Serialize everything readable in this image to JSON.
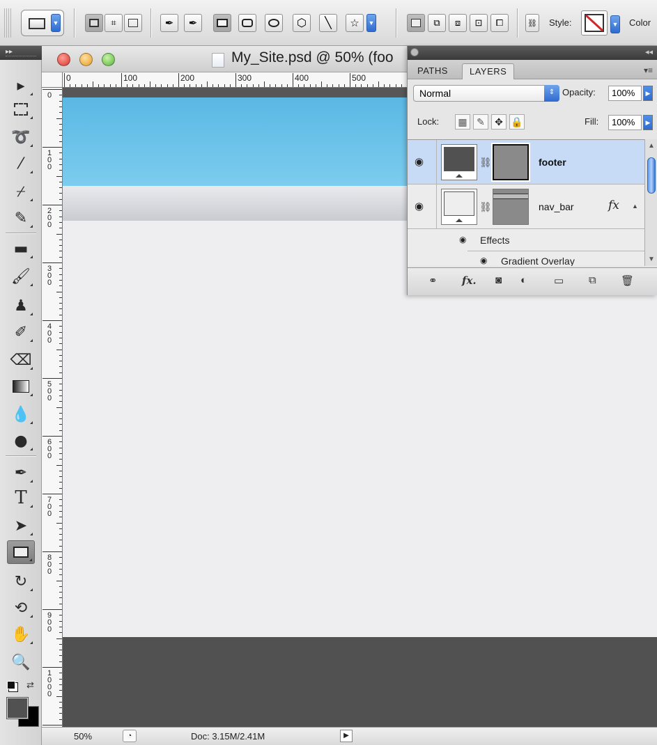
{
  "options_bar": {
    "style_label": "Style:",
    "color_label": "Color",
    "icons": [
      "rectangle-preset-icon",
      "shape-layers-icon",
      "paths-icon",
      "fill-pixels-icon",
      "pen-icon",
      "freeform-pen-icon",
      "rectangle-icon",
      "rounded-rectangle-icon",
      "ellipse-icon",
      "polygon-icon",
      "line-icon",
      "custom-shape-icon",
      "new-layer-icon",
      "add-to-shape-icon",
      "subtract-shape-icon",
      "intersect-shape-icon",
      "exclude-shape-icon",
      "link-icon",
      "no-style-icon"
    ]
  },
  "tools": [
    "move",
    "marquee",
    "lasso",
    "quick-selection",
    "crop",
    "eyedropper",
    "spot-healing",
    "brush",
    "clone-stamp",
    "history-brush",
    "eraser",
    "gradient",
    "blur",
    "dodge",
    "pen",
    "type",
    "path-selection",
    "rectangle-shape",
    "3d-rotate",
    "3d-orbit",
    "hand",
    "zoom"
  ],
  "document": {
    "title": "My_Site.psd @ 50% (foo",
    "ruler_h": [
      "0",
      "100",
      "200",
      "300",
      "400",
      "500"
    ],
    "ruler_v": [
      "0",
      "100",
      "200",
      "300",
      "400",
      "500",
      "600",
      "700",
      "800",
      "900",
      "1000"
    ]
  },
  "status": {
    "zoom": "50%",
    "doc": "Doc: 3.15M/2.41M"
  },
  "layers_panel": {
    "tabs": [
      "PATHS",
      "LAYERS"
    ],
    "active_tab": "LAYERS",
    "blend_mode": "Normal",
    "opacity_label": "Opacity:",
    "opacity": "100%",
    "lock_label": "Lock:",
    "fill_label": "Fill:",
    "fill": "100%",
    "layers": [
      {
        "name": "footer",
        "selected": true
      },
      {
        "name": "nav_bar",
        "selected": false,
        "fx": "fx"
      }
    ],
    "effects_label": "Effects",
    "effect_item": "Gradient Overlay"
  },
  "colors": {
    "header_blue": "#5ab8e4",
    "footer_gray": "#515151",
    "selection_blue": "#c7daf6"
  }
}
